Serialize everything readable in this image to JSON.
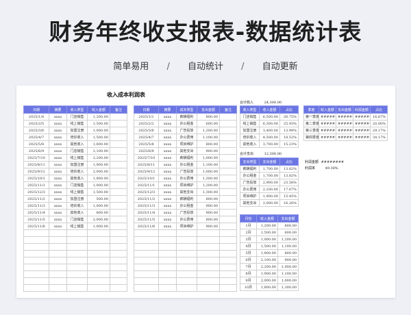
{
  "header": {
    "title": "财务年终收支报表-数据统计表",
    "features": [
      "简单易用",
      "自动统计",
      "自动更新"
    ],
    "separator": "/"
  },
  "sheet": {
    "title": "收入成本利润表",
    "income_table": {
      "headers": [
        "日期",
        "摘要",
        "收入类型",
        "收入金额",
        "备注"
      ],
      "rows": [
        [
          "2025/1/4",
          "xxxx",
          "门店销售",
          "1,200.00",
          ""
        ],
        [
          "2025/2/5",
          "xxxx",
          "线上销售",
          "1,500.00",
          ""
        ],
        [
          "2025/3/6",
          "xxxx",
          "加盟注册",
          "1,000.00",
          ""
        ],
        [
          "2025/4/7",
          "xxxx",
          "培训收入",
          "1,500.00",
          ""
        ],
        [
          "2025/5/8",
          "xxxx",
          "其他收入",
          "1,800.00",
          ""
        ],
        [
          "2025/6/9",
          "xxxx",
          "门店销售",
          "2,100.00",
          ""
        ],
        [
          "2025/7/10",
          "xxxx",
          "线上销售",
          "2,200.00",
          ""
        ],
        [
          "2025/8/11",
          "xxxx",
          "加盟注册",
          "1,900.00",
          ""
        ],
        [
          "2025/9/12",
          "xxxx",
          "培训收入",
          "2,000.00",
          ""
        ],
        [
          "2025/10/1",
          "xxxx",
          "其他收入",
          "1,800.00",
          ""
        ],
        [
          "2025/11/1",
          "xxxx",
          "门店销售",
          "1,000.00",
          ""
        ],
        [
          "2025/12/3",
          "xxxx",
          "线上销售",
          "1,500.00",
          ""
        ],
        [
          "2025/11/2",
          "xxxx",
          "加盟注册",
          "500.00",
          ""
        ],
        [
          "2025/11/3",
          "xxxx",
          "培训收入",
          "1,000.00",
          ""
        ],
        [
          "2025/11/4",
          "xxxx",
          "其他收入",
          "800.00",
          ""
        ],
        [
          "2025/11/5",
          "xxxx",
          "门店销售",
          "2,000.00",
          ""
        ],
        [
          "2025/11/6",
          "xxxx",
          "线上销售",
          "1,000.00",
          ""
        ]
      ],
      "blank_rows": 9
    },
    "expense_table": {
      "headers": [
        "日期",
        "摘要",
        "成本类型",
        "支出金额",
        "备注"
      ],
      "rows": [
        [
          "2025/1/1",
          "xxxx",
          "薪酬福利",
          "800.00",
          ""
        ],
        [
          "2025/2/2",
          "xxxx",
          "办公租金",
          "600.00",
          ""
        ],
        [
          "2025/3/6",
          "xxxx",
          "广告投放",
          "1,200.00",
          ""
        ],
        [
          "2025/4/7",
          "xxxx",
          "办公费用",
          "1,100.00",
          ""
        ],
        [
          "2025/5/8",
          "xxxx",
          "项目维护",
          "800.00",
          ""
        ],
        [
          "2025/6/9",
          "xxxx",
          "其他支出",
          "900.00",
          ""
        ],
        [
          "2025/7/10",
          "xxxx",
          "薪酬福利",
          "1,000.00",
          ""
        ],
        [
          "2025/8/11",
          "xxxx",
          "办公租金",
          "1,100.00",
          ""
        ],
        [
          "2025/9/12",
          "xxxx",
          "广告投放",
          "1,000.00",
          ""
        ],
        [
          "2025/10/1",
          "xxxx",
          "办公费用",
          "1,300.00",
          ""
        ],
        [
          "2025/11/1",
          "xxxx",
          "项目维护",
          "1,200.00",
          ""
        ],
        [
          "2025/12/3",
          "xxxx",
          "其他支出",
          "1,300.00",
          ""
        ],
        [
          "2025/11/2",
          "xxxx",
          "薪酬福利",
          "800.00",
          ""
        ],
        [
          "2025/11/3",
          "xxxx",
          "办公租金",
          "900.00",
          ""
        ],
        [
          "2025/11/4",
          "xxxx",
          "广告投放",
          "900.00",
          ""
        ],
        [
          "2025/11/5",
          "xxxx",
          "办公费用",
          "800.00",
          ""
        ],
        [
          "2025/11/6",
          "xxxx",
          "项目维护",
          "900.00",
          ""
        ]
      ],
      "blank_rows": 9
    },
    "total_income": {
      "label": "合计收入",
      "value": "24,300.00"
    },
    "income_type_table": {
      "headers": [
        "收入类型",
        "收入金额",
        "占比"
      ],
      "rows": [
        [
          "门店销售",
          "6,500.00",
          "26.75%"
        ],
        [
          "线上销售",
          "6,300.00",
          "25.93%"
        ],
        [
          "加盟注册",
          "3,400.00",
          "13.99%"
        ],
        [
          "培训收入",
          "4,500.00",
          "18.52%"
        ],
        [
          "其他收入",
          "3,700.00",
          "15.23%"
        ]
      ]
    },
    "total_expense": {
      "label": "合计支出",
      "value": "12,300.00"
    },
    "expense_type_table": {
      "headers": [
        "支出类型",
        "支出金额",
        "占比"
      ],
      "rows": [
        [
          "薪酬福利",
          "1,700.00",
          "13.82%"
        ],
        [
          "办公租金",
          "1,700.00",
          "13.82%"
        ],
        [
          "广告投放",
          "2,900.00",
          "23.58%"
        ],
        [
          "办公费用",
          "2,100.00",
          "17.07%"
        ],
        [
          "项目维护",
          "1,900.00",
          "15.45%"
        ],
        [
          "其他支出",
          "2,000.00",
          "16.26%"
        ]
      ]
    },
    "monthly_table": {
      "headers": [
        "月份",
        "收入金额",
        "支出金额"
      ],
      "rows": [
        [
          "1月",
          "1,200.00",
          "800.00"
        ],
        [
          "2月",
          "1,500.00",
          "600.00"
        ],
        [
          "3月",
          "1,000.00",
          "1,200.00"
        ],
        [
          "4月",
          "1,500.00",
          "1,100.00"
        ],
        [
          "5月",
          "1,800.00",
          "800.00"
        ],
        [
          "6月",
          "2,100.00",
          "900.00"
        ],
        [
          "7月",
          "2,200.00",
          "1,000.00"
        ],
        [
          "8月",
          "1,900.00",
          "1,100.00"
        ],
        [
          "9月",
          "2,000.00",
          "1,000.00"
        ],
        [
          "10月",
          "1,800.00",
          "1,300.00"
        ]
      ]
    },
    "quarter_table": {
      "headers": [
        "季度",
        "收入金额",
        "支出金额",
        "利润金额",
        "占比"
      ],
      "rows": [
        [
          "第一季度",
          "########",
          "########",
          "########",
          "16.67%"
        ],
        [
          "第二季度",
          "########",
          "########",
          "########",
          "20.00%"
        ],
        [
          "第三季度",
          "########",
          "########",
          "########",
          "29.17%"
        ],
        [
          "第四季度",
          "########",
          "########",
          "########",
          "34.17%"
        ]
      ]
    },
    "profit": {
      "amount_label": "利润金额",
      "amount_value": "########",
      "rate_label": "利润率",
      "rate_value": "49.38%"
    }
  }
}
